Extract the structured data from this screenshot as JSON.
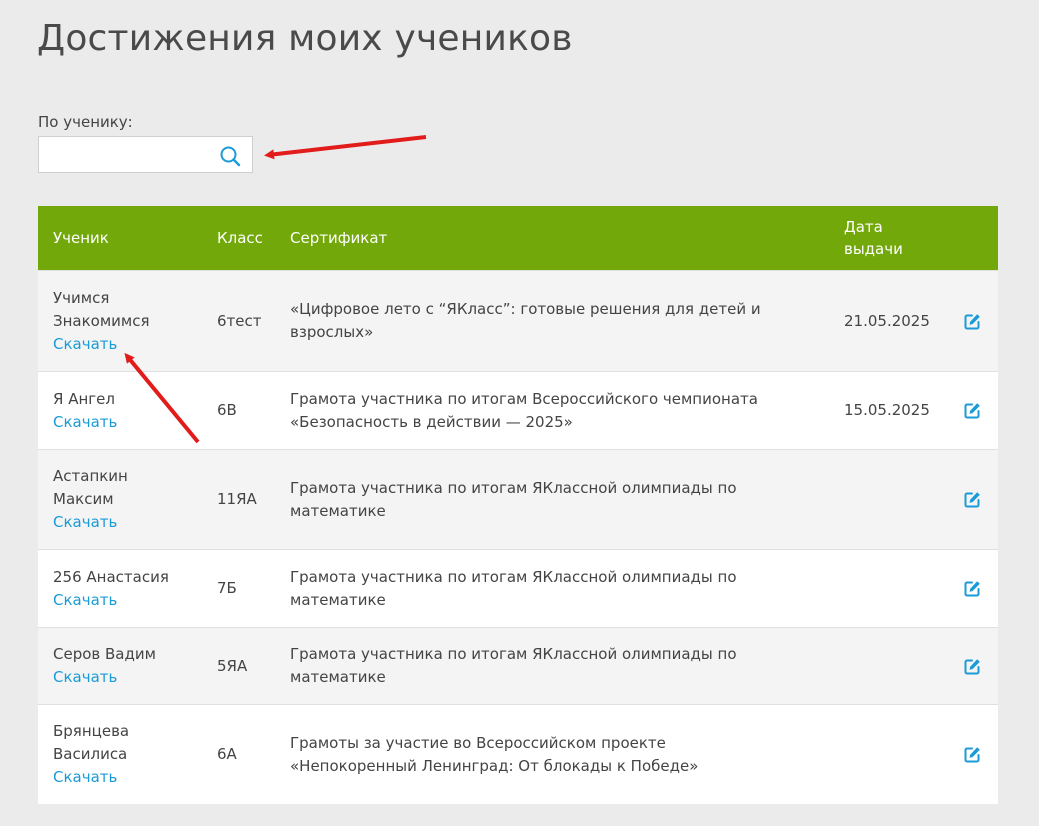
{
  "page": {
    "title": "Достижения моих учеников"
  },
  "filter": {
    "label": "По ученику:",
    "value": "",
    "placeholder": ""
  },
  "table": {
    "headers": {
      "student": "Ученик",
      "class": "Класс",
      "certificate": "Сертификат",
      "date_line1": "Дата",
      "date_line2": "выдачи"
    },
    "download_label": "Скачать",
    "rows": [
      {
        "student_line1": "Учимся",
        "student_line2": "Знакомимся",
        "class": "6тест",
        "certificate": "«Цифровое лето с “ЯКласс”: готовые решения для детей и взрослых»",
        "date": "21.05.2025"
      },
      {
        "student_line1": "Я Ангел",
        "student_line2": "",
        "class": "6В",
        "certificate": "Грамота участника по итогам Всероссийского чемпионата «Безопасность в действии — 2025»",
        "date": "15.05.2025"
      },
      {
        "student_line1": "Астапкин",
        "student_line2": "Максим",
        "class": "11ЯА",
        "certificate": "Грамота участника по итогам ЯКлассной олимпиады по математике",
        "date": ""
      },
      {
        "student_line1": "256 Анастасия",
        "student_line2": "",
        "class": "7Б",
        "certificate": "Грамота участника по итогам ЯКлассной олимпиады по математике",
        "date": ""
      },
      {
        "student_line1": "Серов Вадим",
        "student_line2": "",
        "class": "5ЯА",
        "certificate": "Грамота участника по итогам ЯКлассной олимпиады по математике",
        "date": ""
      },
      {
        "student_line1": "Брянцева",
        "student_line2": "Василиса",
        "class": "6А",
        "certificate": "Грамоты за участие во Всероссийском проекте «Непокоренный Ленинград: От блокады к Победе»",
        "date": ""
      }
    ]
  },
  "icons": {
    "search": "search-icon",
    "edit": "edit-icon"
  },
  "colors": {
    "header_bg": "#72a80a",
    "link": "#1a9bd7",
    "icon": "#1a9bd7",
    "annotation_arrow": "#e21b1b"
  }
}
